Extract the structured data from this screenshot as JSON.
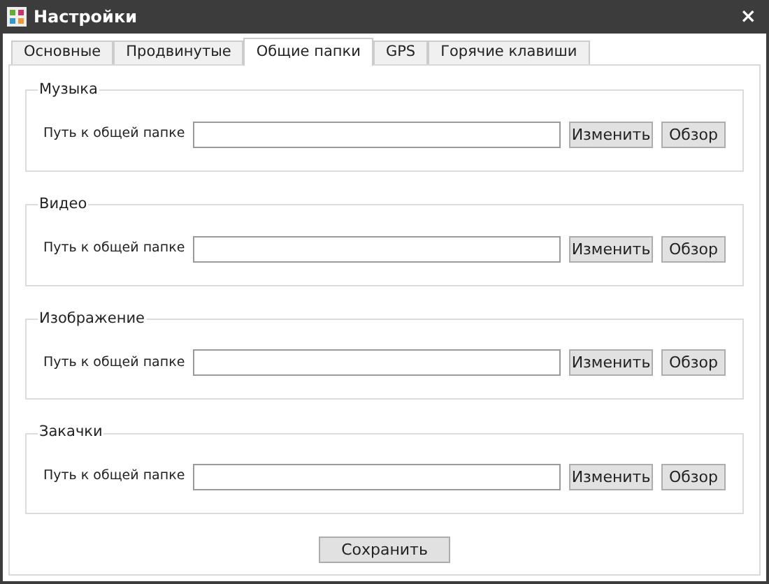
{
  "window": {
    "title": "Настройки",
    "close": "×"
  },
  "tabs": [
    {
      "label": "Основные",
      "selected": false
    },
    {
      "label": "Продвинутые",
      "selected": false
    },
    {
      "label": "Общие папки",
      "selected": true
    },
    {
      "label": "GPS",
      "selected": false
    },
    {
      "label": "Горячие клавиши",
      "selected": false
    }
  ],
  "groups": [
    {
      "title": "Музыка",
      "label": "Путь к общей папке",
      "change": "Изменить",
      "browse": "Обзор"
    },
    {
      "title": "Видео",
      "label": "Путь к общей папке",
      "change": "Изменить",
      "browse": "Обзор"
    },
    {
      "title": "Изображение",
      "label": "Путь к общей папке",
      "change": "Изменить",
      "browse": "Обзор"
    },
    {
      "title": "Закачки",
      "label": "Путь к общей папке",
      "change": "Изменить",
      "browse": "Обзор"
    }
  ],
  "save": "Сохранить"
}
